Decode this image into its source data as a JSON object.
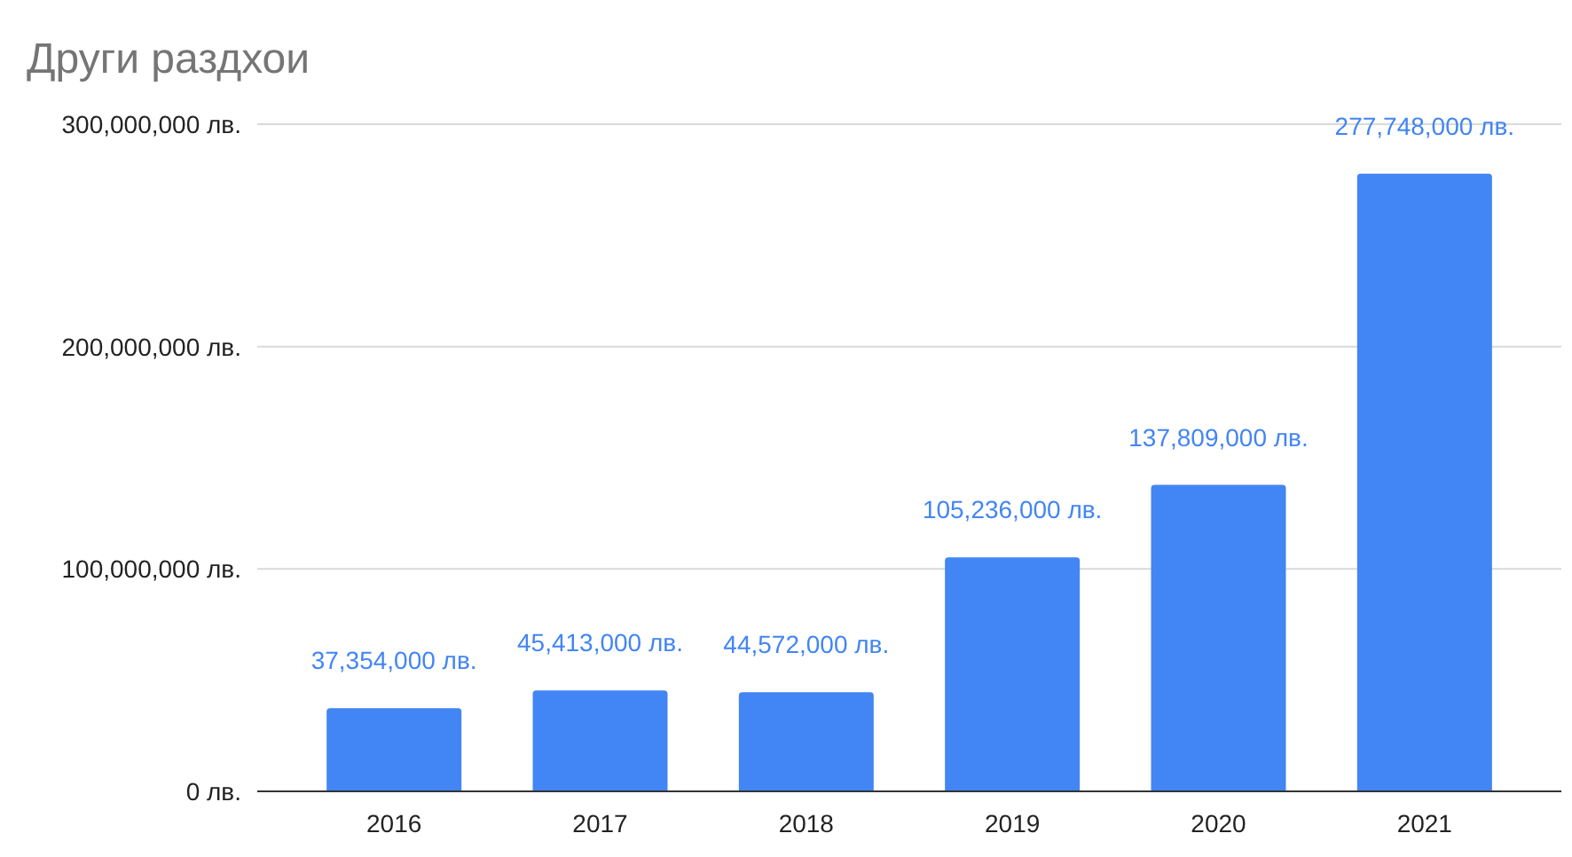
{
  "chart": {
    "chart_data": {
      "type": "bar",
      "title": "Други раздхои",
      "categories": [
        "2016",
        "2017",
        "2018",
        "2019",
        "2020",
        "2021"
      ],
      "series": [
        {
          "color": "#4285f4",
          "values": [
            37354000,
            45413000,
            44572000,
            105236000,
            137809000,
            277748000
          ]
        }
      ],
      "ylim": [
        0,
        300000000
      ],
      "yticks": [
        {
          "value": 0,
          "label": "0 лв."
        },
        {
          "value": 100000000,
          "label": "100,000,000 лв."
        },
        {
          "value": 200000000,
          "label": "200,000,000 лв."
        },
        {
          "value": 300000000,
          "label": "300,000,000 лв."
        }
      ],
      "value_labels": [
        "37,354,000 лв.",
        "45,413,000 лв.",
        "44,572,000 лв.",
        "105,236,000 лв.",
        "137,809,000 лв.",
        "277,748,000 лв."
      ]
    }
  }
}
